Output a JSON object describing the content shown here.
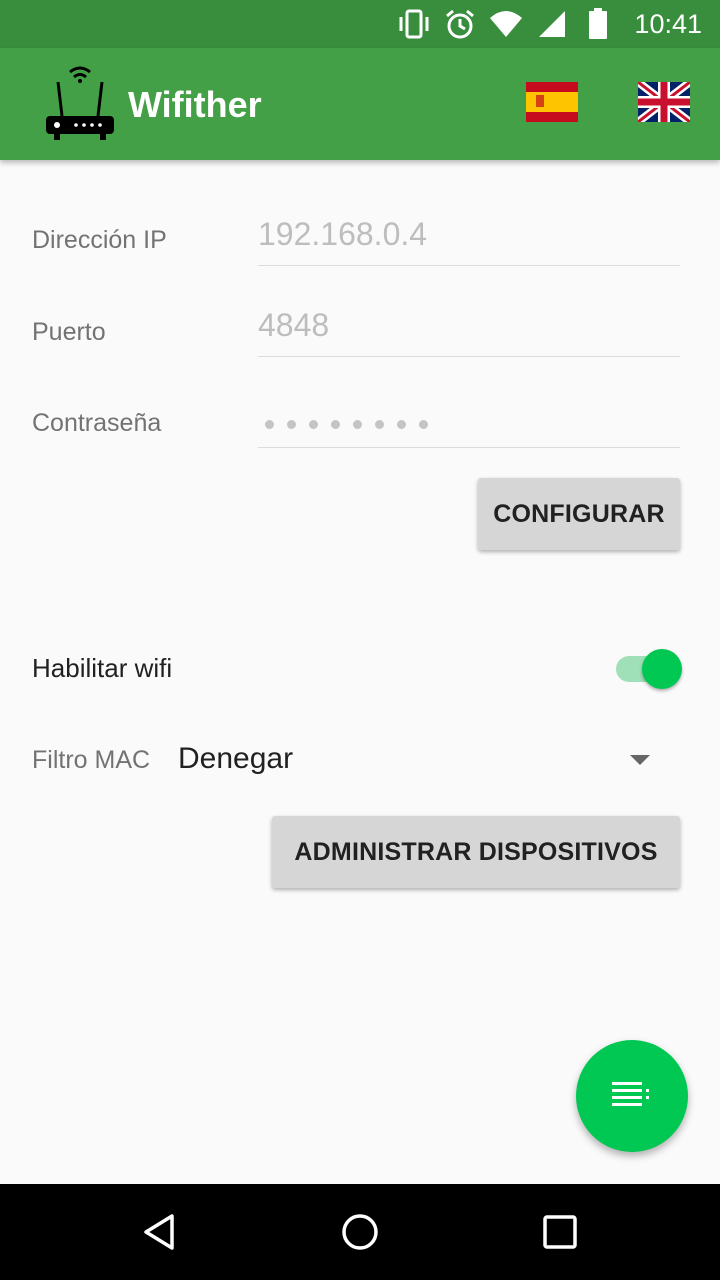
{
  "status_bar": {
    "time": "10:41",
    "icons": [
      "vibrate-icon",
      "alarm-icon",
      "wifi-signal-icon",
      "cell-signal-icon",
      "battery-icon"
    ]
  },
  "app_bar": {
    "title": "Wifither",
    "logo_icon": "router-icon",
    "languages": [
      "flag-spain-icon",
      "flag-uk-icon"
    ]
  },
  "form": {
    "ip_label": "Dirección IP",
    "ip_placeholder": "192.168.0.4",
    "port_label": "Puerto",
    "port_placeholder": "4848",
    "password_label": "Contraseña",
    "password_masked_length": 8,
    "configure_button": "CONFIGURAR"
  },
  "wifi": {
    "enable_label": "Habilitar wifi",
    "enabled": true
  },
  "mac_filter": {
    "label": "Filtro MAC",
    "selected": "Denegar",
    "manage_button": "ADMINISTRAR DISPOSITIVOS"
  },
  "fab": {
    "icon": "list-icon"
  },
  "nav_bar": {
    "icons": [
      "back-icon",
      "home-icon",
      "recents-icon"
    ]
  },
  "colors": {
    "status_bar": "#388e3c",
    "app_bar": "#43a047",
    "accent": "#00c853"
  }
}
